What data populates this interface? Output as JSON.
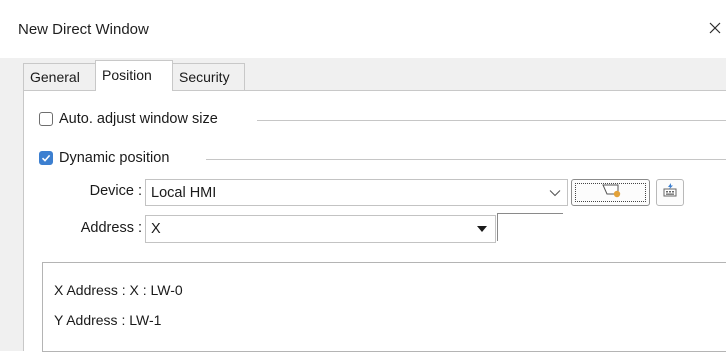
{
  "window": {
    "title": "New Direct Window"
  },
  "tabs": [
    {
      "label": "General",
      "active": false
    },
    {
      "label": "Position",
      "active": true
    },
    {
      "label": "Security",
      "active": false
    }
  ],
  "auto_adjust": {
    "label": "Auto. adjust window size",
    "checked": false
  },
  "dynamic_position": {
    "label": "Dynamic position",
    "checked": true
  },
  "device": {
    "label": "Device :",
    "value": "Local HMI"
  },
  "address": {
    "label": "Address :",
    "value": "X",
    "input_value": ""
  },
  "info": {
    "x_address": "X Address : X : LW-0",
    "y_address": "Y Address : LW-1"
  },
  "icons": {
    "close": "close-icon",
    "device_settings": "device-settings-icon",
    "address_keypad": "address-keypad-icon"
  },
  "colors": {
    "accent": "#3c7fd0",
    "panel_bg": "#ffffff",
    "dialog_bg": "#f0f0f0"
  }
}
